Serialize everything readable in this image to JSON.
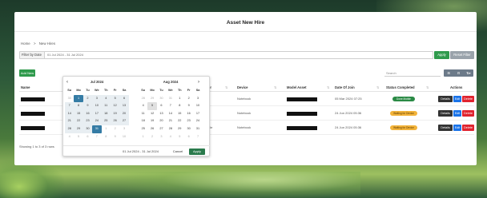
{
  "page": {
    "title": "Asset New Hire",
    "breadcrumbs": [
      "Home",
      ">",
      "New Hires"
    ]
  },
  "filter": {
    "label": "Filter by Date",
    "value": "01 Jul 2024 - 31 Jul 2024",
    "apply_label": "Apply",
    "reset_label": "Reset Filter"
  },
  "toolbar": {
    "add_new_label": "Add New",
    "search_placeholder": "Search",
    "view_icons": [
      "⊞",
      "⊟",
      "⇅▾"
    ]
  },
  "table": {
    "columns": [
      "Name",
      "er",
      "Device",
      "Model Asset",
      "Date Of Join",
      "Status Completed",
      "Actions"
    ],
    "rows": [
      {
        "manager_fragment": "",
        "device": "Notebook",
        "date": "05 Mar 2024 07:25",
        "status": "Done Mobile",
        "status_color": "#2a8a45"
      },
      {
        "manager_fragment": "",
        "device": "Notebook",
        "date": "24 Jun 2024 05:36",
        "status": "Waiting for Device",
        "status_color": "#f2b33a"
      },
      {
        "manager_fragment": "ble",
        "device": "Notebook",
        "date": "24 Jun 2024 05:36",
        "status": "Waiting for Device",
        "status_color": "#f2b33a"
      }
    ],
    "actions": {
      "details": "Details",
      "edit": "Edit",
      "delete": "Delete"
    },
    "footer": "Showing 1 to 3 of 3 rows"
  },
  "datepicker": {
    "prev_icon": "‹",
    "next_icon": "›",
    "weekdays": [
      "Su",
      "Mo",
      "Tu",
      "We",
      "Th",
      "Fr",
      "Sa"
    ],
    "left_month": {
      "label": "Jul 2024",
      "days": [
        "30",
        "1",
        "2",
        "3",
        "4",
        "5",
        "6",
        "7",
        "8",
        "9",
        "10",
        "11",
        "12",
        "13",
        "14",
        "15",
        "16",
        "17",
        "18",
        "19",
        "20",
        "21",
        "22",
        "23",
        "24",
        "25",
        "26",
        "27",
        "28",
        "29",
        "30",
        "31",
        "1",
        "2",
        "3",
        "4",
        "5",
        "6",
        "7",
        "8",
        "9",
        "10"
      ]
    },
    "right_month": {
      "label": "Aug 2024",
      "days": [
        "28",
        "29",
        "30",
        "31",
        "1",
        "2",
        "3",
        "4",
        "5",
        "6",
        "7",
        "8",
        "9",
        "10",
        "11",
        "12",
        "13",
        "14",
        "15",
        "16",
        "17",
        "18",
        "19",
        "20",
        "21",
        "22",
        "23",
        "24",
        "25",
        "26",
        "27",
        "28",
        "29",
        "30",
        "31",
        "1",
        "2",
        "3",
        "4",
        "5",
        "6",
        "7"
      ]
    },
    "range_text": "01 Jul 2024 - 31 Jul 2024",
    "cancel_label": "Cancel",
    "apply_label": "Apply"
  }
}
